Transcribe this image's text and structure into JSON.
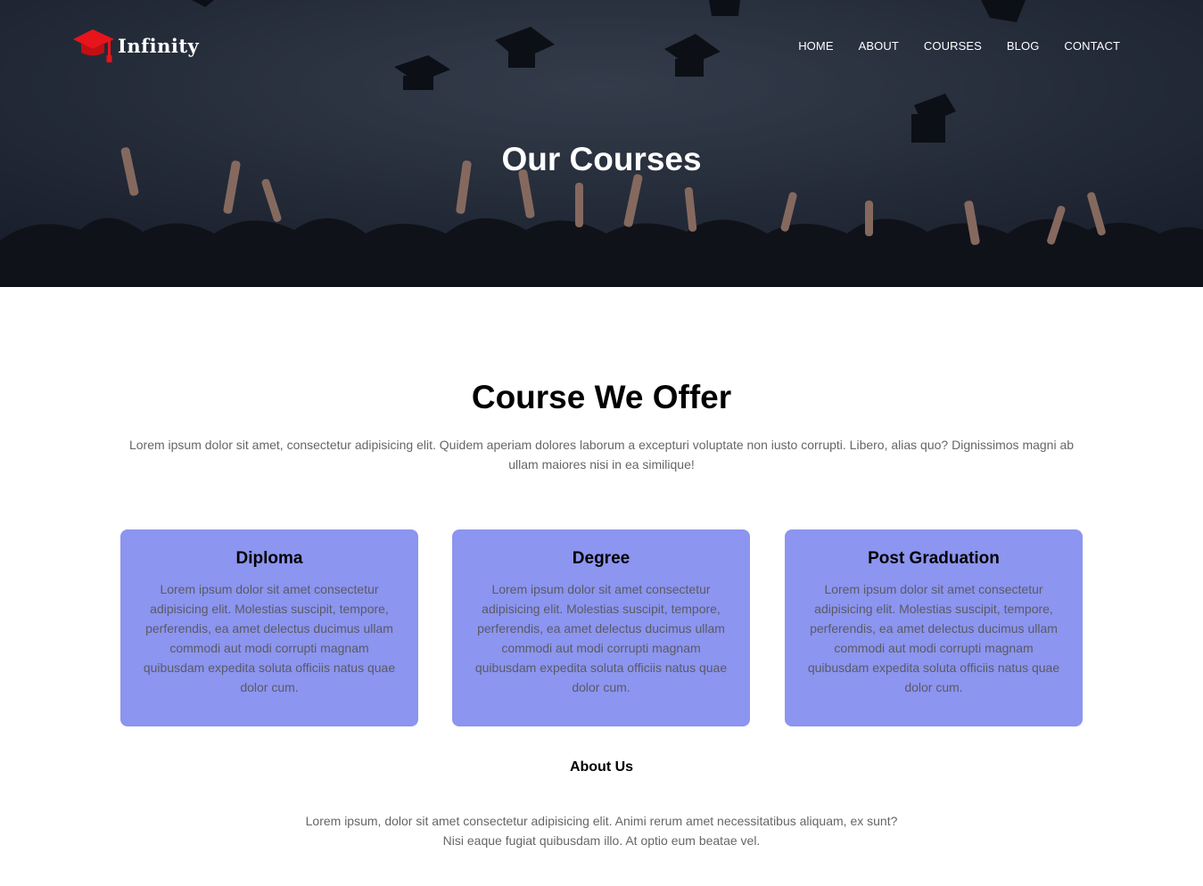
{
  "brand": {
    "name": "Infinity",
    "logo_icon": "graduation-cap-icon",
    "accent_color": "#e8141b"
  },
  "nav": {
    "items": [
      "HOME",
      "ABOUT",
      "COURSES",
      "BLOG",
      "CONTACT"
    ]
  },
  "hero": {
    "title": "Our Courses"
  },
  "courses": {
    "title": "Course We Offer",
    "description": "Lorem ipsum dolor sit amet, consectetur adipisicing elit. Quidem aperiam dolores laborum a excepturi voluptate non iusto corrupti. Libero, alias quo? Dignissimos magni ab ullam maiores nisi in ea similique!",
    "card_color": "#8c95ef",
    "cards": [
      {
        "title": "Diploma",
        "text": "Lorem ipsum dolor sit amet consectetur adipisicing elit. Molestias suscipit, tempore, perferendis, ea amet delectus ducimus ullam commodi aut modi corrupti magnam quibusdam expedita soluta officiis natus quae dolor cum."
      },
      {
        "title": "Degree",
        "text": "Lorem ipsum dolor sit amet consectetur adipisicing elit. Molestias suscipit, tempore, perferendis, ea amet delectus ducimus ullam commodi aut modi corrupti magnam quibusdam expedita soluta officiis natus quae dolor cum."
      },
      {
        "title": "Post Graduation",
        "text": "Lorem ipsum dolor sit amet consectetur adipisicing elit. Molestias suscipit, tempore, perferendis, ea amet delectus ducimus ullam commodi aut modi corrupti magnam quibusdam expedita soluta officiis natus quae dolor cum."
      }
    ]
  },
  "about": {
    "title": "About Us",
    "line1": "Lorem ipsum, dolor sit amet consectetur adipisicing elit. Animi rerum amet necessitatibus aliquam, ex sunt?",
    "line2": "Nisi eaque fugiat quibusdam illo. At optio eum beatae vel."
  }
}
